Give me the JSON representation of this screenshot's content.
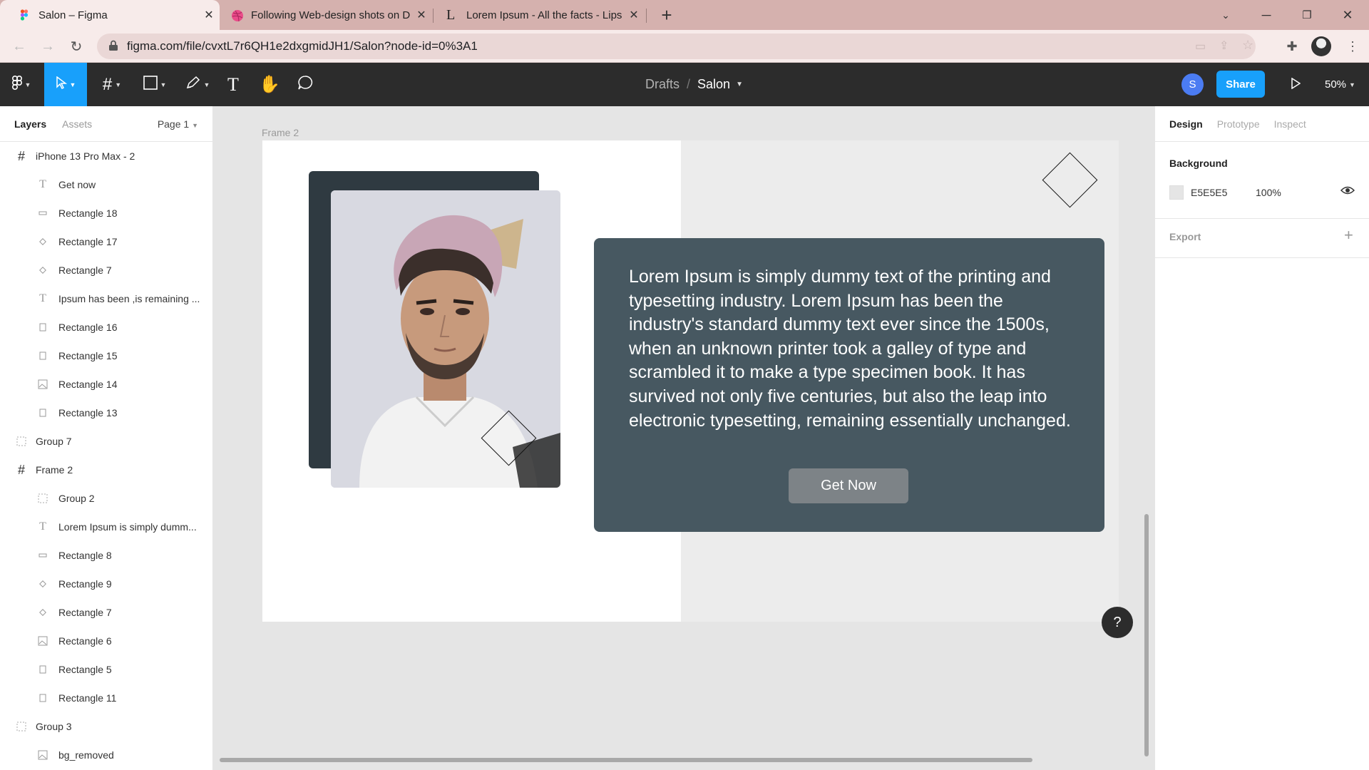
{
  "browser": {
    "tabs": [
      {
        "title": "Salon – Figma",
        "active": true,
        "icon": "figma-icon"
      },
      {
        "title": "Following Web-design shots on D",
        "active": false,
        "icon": "dribbble-icon"
      },
      {
        "title": "Lorem Ipsum - All the facts - Lips",
        "active": false,
        "icon": "lipsum-icon"
      }
    ],
    "url": "figma.com/file/cvxtL7r6QH1e2dxgmidJH1/Salon?node-id=0%3A1"
  },
  "figma": {
    "breadcrumb": {
      "drafts": "Drafts",
      "separator": "/",
      "file": "Salon"
    },
    "avatar_letter": "S",
    "share_label": "Share",
    "zoom": "50%"
  },
  "left_panel": {
    "tab_layers": "Layers",
    "tab_assets": "Assets",
    "page": "Page 1",
    "layers": [
      {
        "label": "iPhone 13 Pro Max - 2",
        "icon": "frame-icon",
        "indent": 0
      },
      {
        "label": "Get now",
        "icon": "text-icon",
        "indent": 1
      },
      {
        "label": "Rectangle 18",
        "icon": "rectangle-wide-icon",
        "indent": 1
      },
      {
        "label": "Rectangle 17",
        "icon": "diamond-icon",
        "indent": 1
      },
      {
        "label": "Rectangle 7",
        "icon": "diamond-icon",
        "indent": 1
      },
      {
        "label": "Ipsum has been ,is remaining ...",
        "icon": "text-icon",
        "indent": 1
      },
      {
        "label": "Rectangle 16",
        "icon": "rectangle-icon",
        "indent": 1
      },
      {
        "label": "Rectangle 15",
        "icon": "rectangle-icon",
        "indent": 1
      },
      {
        "label": "Rectangle 14",
        "icon": "image-icon",
        "indent": 1
      },
      {
        "label": "Rectangle 13",
        "icon": "rectangle-icon",
        "indent": 1
      },
      {
        "label": "Group 7",
        "icon": "group-icon",
        "indent": 0
      },
      {
        "label": "Frame 2",
        "icon": "frame-icon",
        "indent": 0
      },
      {
        "label": "Group 2",
        "icon": "group-icon",
        "indent": 1
      },
      {
        "label": "Lorem Ipsum is simply dumm...",
        "icon": "text-icon",
        "indent": 1
      },
      {
        "label": "Rectangle 8",
        "icon": "rectangle-wide-icon",
        "indent": 1
      },
      {
        "label": "Rectangle 9",
        "icon": "diamond-icon",
        "indent": 1
      },
      {
        "label": "Rectangle 7",
        "icon": "diamond-icon",
        "indent": 1
      },
      {
        "label": "Rectangle 6",
        "icon": "image-icon",
        "indent": 1
      },
      {
        "label": "Rectangle 5",
        "icon": "rectangle-icon",
        "indent": 1
      },
      {
        "label": "Rectangle 11",
        "icon": "rectangle-icon",
        "indent": 1
      },
      {
        "label": "Group 3",
        "icon": "group-icon",
        "indent": 0
      },
      {
        "label": "bg_removed",
        "icon": "image-icon",
        "indent": 1
      }
    ]
  },
  "right_panel": {
    "tabs": [
      "Design",
      "Prototype",
      "Inspect"
    ],
    "background_title": "Background",
    "background_hex": "E5E5E5",
    "background_opacity": "100%",
    "export_title": "Export"
  },
  "canvas": {
    "frame_label": "Frame 2",
    "card_text": "Lorem Ipsum is simply dummy text of the printing and typesetting industry. Lorem Ipsum has been the industry's standard dummy text ever since the 1500s, when an unknown printer took a galley of type and scrambled it to make a type specimen book. It has survived not only five centuries, but also the leap into electronic typesetting, remaining essentially unchanged.",
    "button_label": "Get Now"
  },
  "help_label": "?",
  "colors": {
    "accent": "#18a0fb",
    "toolbar": "#2c2c2c",
    "card": "#475861",
    "dark_block": "#2f3a41"
  }
}
